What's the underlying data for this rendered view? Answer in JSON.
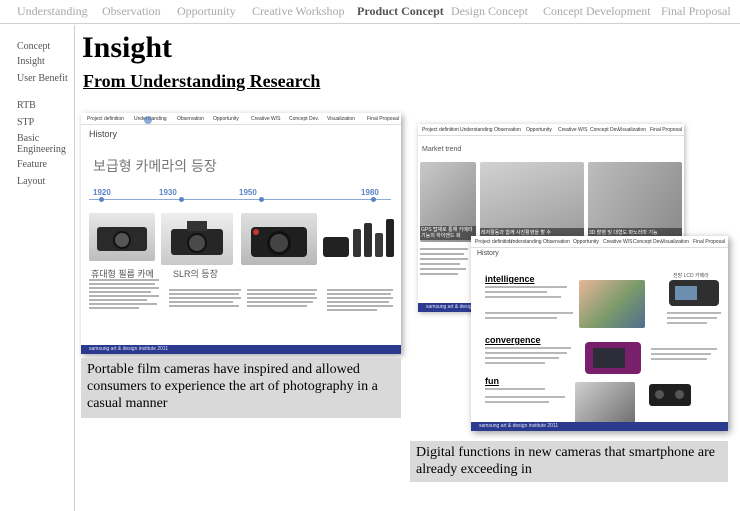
{
  "topnav": {
    "items": [
      "Understanding",
      "Observation",
      "Opportunity",
      "Creative Workshop",
      "Product Concept",
      "Design Concept",
      "Concept Development",
      "Final Proposal"
    ],
    "active": "Product Concept"
  },
  "sidenav": {
    "items": [
      "Concept",
      "Insight",
      "User Benefit",
      "RTB",
      "STP",
      "Basic Engineering",
      "Feature",
      "Layout"
    ]
  },
  "page": {
    "title": "Insight",
    "subtitle": "From Understanding Research"
  },
  "slide_history": {
    "nav": [
      "Project definition",
      "Understanding",
      "Observation",
      "Opportunity",
      "Creative W/S",
      "Concept Dev.",
      "Visualization",
      "Final Proposal"
    ],
    "heading": "History",
    "korean_title": "보급형 카메라의 등장",
    "years": [
      "1920",
      "1930",
      "1950",
      "1980"
    ],
    "sub1": "휴대형 필름 카메",
    "sub2": "SLR의 등장",
    "footer": "samsung  art & design institute  2011"
  },
  "slide_market": {
    "nav": [
      "Project definition",
      "Understanding",
      "Observation",
      "Opportunity",
      "Creative W/S",
      "Concept Dev.",
      "Visualization",
      "Final Proposal"
    ],
    "heading": "Market trend",
    "labels": [
      "GPS 탑재로 통해 카메라 기능의 하이엔드 화",
      "레저활동과 함께 사진활영을 할 수",
      "3D 촬영 및 대형도 파노라마 기능"
    ],
    "footer": "samsung  art & design institute"
  },
  "slide_history2": {
    "nav": [
      "Project definition",
      "Understanding",
      "Observation",
      "Opportunity",
      "Creative W/S",
      "Concept Dev.",
      "Visualization",
      "Final Proposal"
    ],
    "heading": "History",
    "sections": [
      {
        "title": "intelligence"
      },
      {
        "title": "convergence"
      },
      {
        "title": "fun"
      }
    ],
    "side_label": "전방 LCD 카메라",
    "footer": "samsung  art & design institute  2011"
  },
  "captions": {
    "left": "Portable film cameras have inspired and allowed consumers to experience the art of photography in a casual manner",
    "right": "Digital functions in new cameras that smartphone are already exceeding in"
  },
  "colors": {
    "nav_inactive": "#a8a8a8",
    "nav_active": "#555555",
    "caption_bg": "#d9d9d9",
    "slide_bar": "#2b3a8f",
    "timeline_blue": "#5b84c4"
  }
}
